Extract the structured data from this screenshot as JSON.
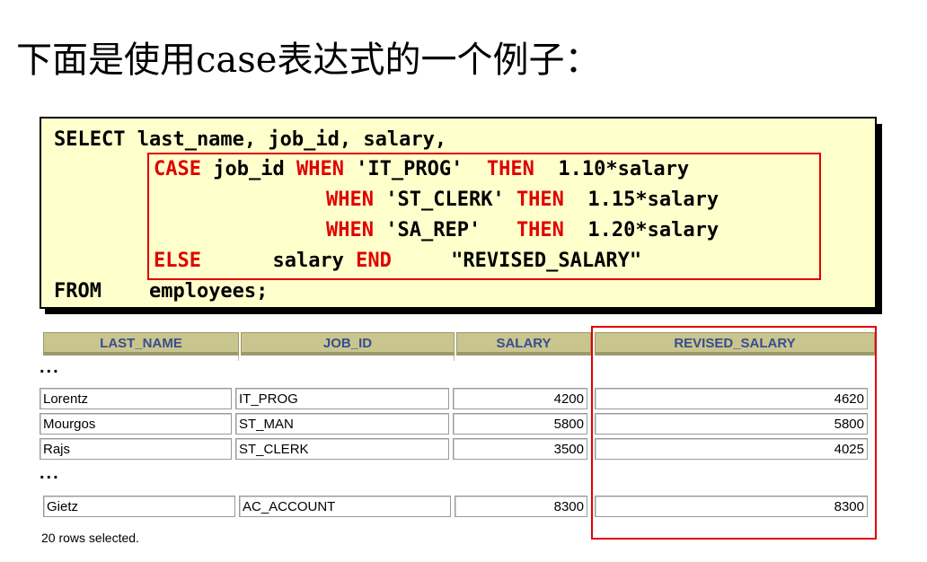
{
  "heading": "下面是使用case表达式的一个例子：",
  "code": {
    "line1": "SELECT last_name, job_id, salary,",
    "case_kw": "CASE",
    "job_id": " job_id ",
    "when_kw": "WHEN",
    "then_kw": "THEN",
    "when1_val": " 'IT_PROG'  ",
    "when1_expr": "  1.10*salary",
    "when2_val": " 'ST_CLERK' ",
    "when2_expr": "  1.15*salary",
    "when3_val": " 'SA_REP'   ",
    "when3_expr": "  1.20*salary",
    "else_kw": "ELSE",
    "else_expr": "      salary ",
    "end_kw": "END",
    "alias": "     \"REVISED_SALARY\"",
    "from_kw": "FROM",
    "from_table": "    employees;"
  },
  "table": {
    "headers": [
      "LAST_NAME",
      "JOB_ID",
      "SALARY",
      "REVISED_SALARY"
    ],
    "ellipsis": "...",
    "rows_group1": [
      {
        "last_name": "Lorentz",
        "job_id": "IT_PROG",
        "salary": "4200",
        "revised": "4620"
      },
      {
        "last_name": "Mourgos",
        "job_id": "ST_MAN",
        "salary": "5800",
        "revised": "5800"
      },
      {
        "last_name": "Rajs",
        "job_id": "ST_CLERK",
        "salary": "3500",
        "revised": "4025"
      }
    ],
    "rows_group2": [
      {
        "last_name": "Gietz",
        "job_id": "AC_ACCOUNT",
        "salary": "8300",
        "revised": "8300"
      }
    ],
    "footer": "20 rows selected."
  },
  "colors": {
    "keyword": "#e00000",
    "code_bg": "#ffffcc",
    "header_bg": "#c9c58e",
    "header_text": "#3a4d8f"
  }
}
